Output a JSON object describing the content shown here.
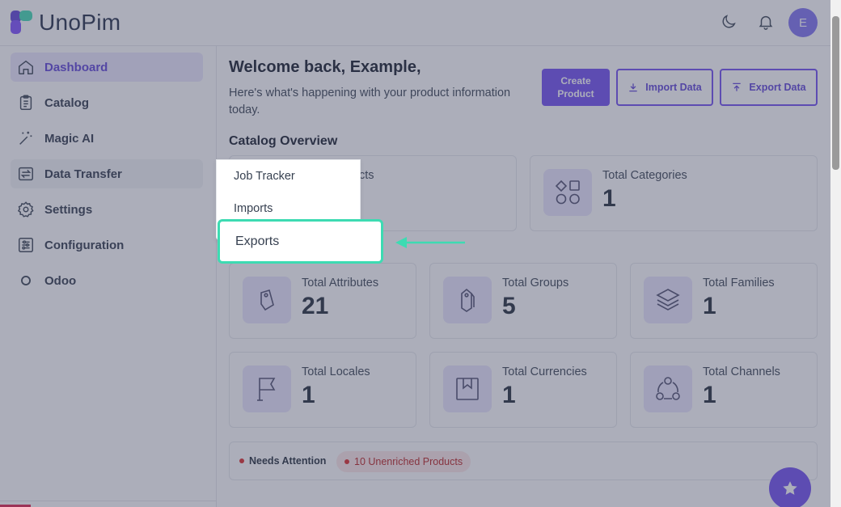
{
  "app": {
    "name": "UnoPim",
    "avatar_initial": "E",
    "accent": "#6d4af0",
    "highlight": "#3ddbb2"
  },
  "header": {
    "icons": [
      "moon-icon",
      "bell-icon"
    ]
  },
  "sidebar": {
    "items": [
      {
        "label": "Dashboard",
        "icon": "home-icon",
        "active": true
      },
      {
        "label": "Catalog",
        "icon": "clipboard-icon"
      },
      {
        "label": "Magic AI",
        "icon": "magic-wand-icon"
      },
      {
        "label": "Data Transfer",
        "icon": "transfer-icon",
        "hover": true
      },
      {
        "label": "Settings",
        "icon": "gear-icon"
      },
      {
        "label": "Configuration",
        "icon": "sliders-icon"
      },
      {
        "label": "Odoo",
        "icon": "circle-icon"
      }
    ]
  },
  "main": {
    "welcome": "Welcome back, Example,",
    "subtitle": "Here's what's happening with your product information today.",
    "buttons": {
      "create": "Create Product",
      "import": "Import Data",
      "export": "Export Data"
    },
    "section_title": "Catalog Overview",
    "cards": {
      "products": {
        "label": "cts"
      },
      "categories": {
        "label": "Total Categories",
        "value": "1"
      },
      "attributes": {
        "label": "Total Attributes",
        "value": "21"
      },
      "groups": {
        "label": "Total Groups",
        "value": "5"
      },
      "families": {
        "label": "Total Families",
        "value": "1"
      },
      "locales": {
        "label": "Total Locales",
        "value": "1"
      },
      "currencies": {
        "label": "Total Currencies",
        "value": "1"
      },
      "channels": {
        "label": "Total Channels",
        "value": "1"
      }
    },
    "attention": {
      "label": "Needs Attention",
      "badge": "10 Unenriched Products"
    }
  },
  "dropdown": {
    "items": [
      "Job Tracker",
      "Imports",
      "Exports"
    ],
    "highlighted": "Exports"
  }
}
